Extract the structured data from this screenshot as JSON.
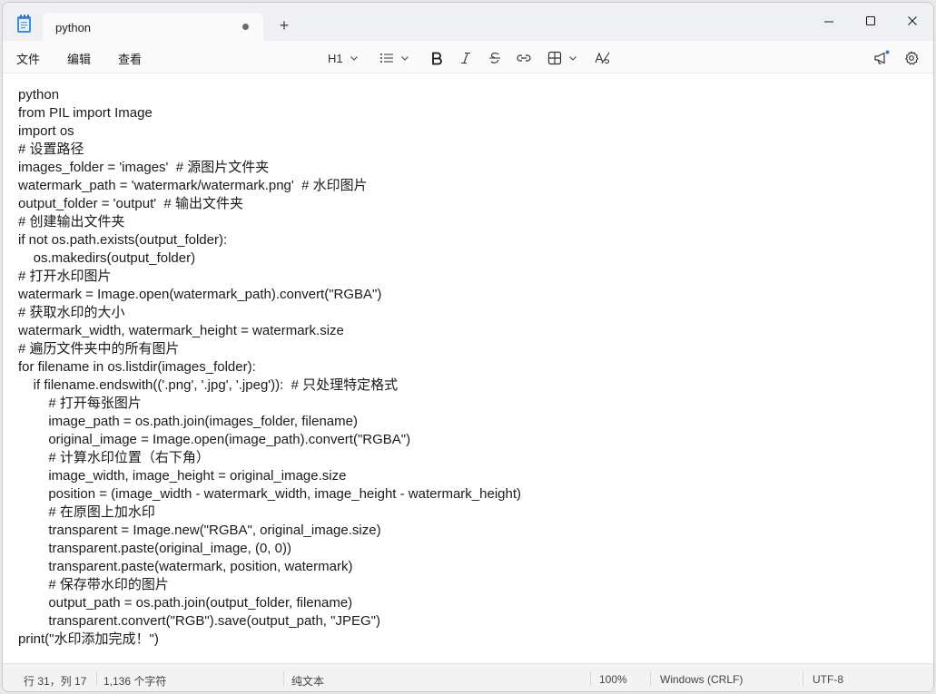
{
  "tab": {
    "title": "python",
    "unsaved_dot": true
  },
  "new_tab_label": "+",
  "menu": {
    "file": "文件",
    "edit": "编辑",
    "view": "查看"
  },
  "toolbar": {
    "heading": "H1",
    "icons": [
      "list-icon",
      "bold-icon",
      "italic-icon",
      "strikethrough-icon",
      "link-icon",
      "table-icon",
      "clear-formatting-icon"
    ]
  },
  "right_icons": [
    "announcement-icon",
    "settings-icon"
  ],
  "colors": {
    "accent": "#0067c0",
    "notification_dot": "#2f7bd6"
  },
  "editor_lines": [
    "python",
    "from PIL import Image",
    "import os",
    "# 设置路径",
    "images_folder = 'images'  # 源图片文件夹",
    "watermark_path = 'watermark/watermark.png'  # 水印图片",
    "output_folder = 'output'  # 输出文件夹",
    "# 创建输出文件夹",
    "if not os.path.exists(output_folder):",
    "    os.makedirs(output_folder)",
    "# 打开水印图片",
    "watermark = Image.open(watermark_path).convert(\"RGBA\")",
    "# 获取水印的大小",
    "watermark_width, watermark_height = watermark.size",
    "# 遍历文件夹中的所有图片",
    "for filename in os.listdir(images_folder):",
    "    if filename.endswith(('.png', '.jpg', '.jpeg')):  # 只处理特定格式",
    "        # 打开每张图片",
    "        image_path = os.path.join(images_folder, filename)",
    "        original_image = Image.open(image_path).convert(\"RGBA\")",
    "        # 计算水印位置（右下角）",
    "        image_width, image_height = original_image.size",
    "        position = (image_width - watermark_width, image_height - watermark_height)",
    "        # 在原图上加水印",
    "        transparent = Image.new(\"RGBA\", original_image.size)",
    "        transparent.paste(original_image, (0, 0))",
    "        transparent.paste(watermark, position, watermark)",
    "        # 保存带水印的图片",
    "        output_path = os.path.join(output_folder, filename)",
    "        transparent.convert(\"RGB\").save(output_path, \"JPEG\")",
    "print(\"水印添加完成！\")"
  ],
  "status": {
    "position": "行 31，列 17",
    "char_count": "1,136 个字符",
    "format": "纯文本",
    "zoom": "100%",
    "line_ending": "Windows (CRLF)",
    "encoding": "UTF-8"
  }
}
